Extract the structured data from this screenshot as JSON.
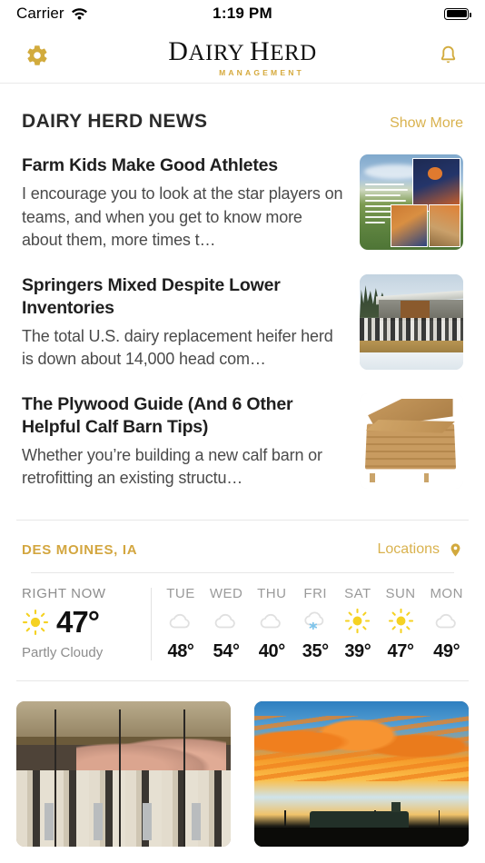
{
  "status_bar": {
    "carrier": "Carrier",
    "wifi_icon": "wifi-icon",
    "time": "1:19 PM",
    "battery_icon": "battery-full-icon"
  },
  "header": {
    "settings_icon": "gear-icon",
    "notifications_icon": "bell-icon",
    "brand_main": "DAIRY HERD",
    "brand_main_d": "D",
    "brand_main_rest": "AIRY ",
    "brand_main_h": "H",
    "brand_main_erd": "ERD",
    "brand_sub": "MANAGEMENT",
    "accent_color": "#d5a93c"
  },
  "news": {
    "title": "DAIRY HERD NEWS",
    "show_more_label": "Show More",
    "articles": [
      {
        "title": "Farm Kids Make Good Athletes",
        "excerpt": "I encourage you to look at the star players on teams, and when you get to know more about them, more times t…",
        "thumbnail": "basketball-collage-thumbnail"
      },
      {
        "title": "Springers Mixed Despite Lower Inventories",
        "excerpt": "The total U.S. dairy replacement heifer herd is down about 14,000 head com…",
        "thumbnail": "dairy-barn-cows-thumbnail"
      },
      {
        "title": "The Plywood Guide (And 6 Other Helpful Calf Barn Tips)",
        "excerpt": "Whether you’re building a new calf barn or retrofitting an existing structu…",
        "thumbnail": "plywood-stack-thumbnail"
      }
    ]
  },
  "weather": {
    "city": "DES MOINES, IA",
    "locations_label": "Locations",
    "locations_icon": "map-pin-icon",
    "right_now_label": "RIGHT NOW",
    "current_temp": "47°",
    "current_icon": "sun-icon",
    "current_condition": "Partly Cloudy",
    "forecast": [
      {
        "day": "TUE",
        "icon": "cloud-icon",
        "temp": "48°"
      },
      {
        "day": "WED",
        "icon": "cloud-icon",
        "temp": "54°"
      },
      {
        "day": "THU",
        "icon": "cloud-icon",
        "temp": "40°"
      },
      {
        "day": "FRI",
        "icon": "cloud-snow-icon",
        "temp": "35°"
      },
      {
        "day": "SAT",
        "icon": "sun-icon",
        "temp": "39°"
      },
      {
        "day": "SUN",
        "icon": "sun-icon",
        "temp": "47°"
      },
      {
        "day": "MON",
        "icon": "cloud-icon",
        "temp": "49°"
      }
    ],
    "sun_color": "#f5d223",
    "cloud_color": "#e0e0e0",
    "snow_color": "#7fc4ea"
  },
  "photo_cards": [
    {
      "name": "milking-parlor-photo-card"
    },
    {
      "name": "sunset-farm-photo-card"
    }
  ]
}
